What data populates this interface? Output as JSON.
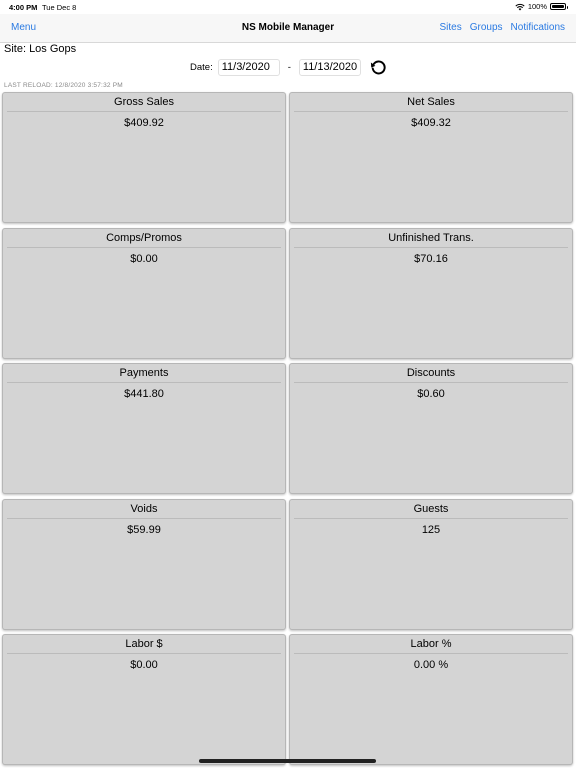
{
  "status_bar": {
    "time": "4:00 PM",
    "date": "Tue Dec 8",
    "battery": "100%",
    "battery_level": 1.0
  },
  "nav": {
    "menu_label": "Menu",
    "title": "NS Mobile Manager",
    "links": [
      "Sites",
      "Groups",
      "Notifications"
    ]
  },
  "site": {
    "label": "Site: Los Gops"
  },
  "date_range": {
    "label": "Date:",
    "start": "11/3/2020",
    "separator": "-",
    "end": "11/13/2020"
  },
  "last_reload": "LAST RELOAD: 12/8/2020 3:57:32 PM",
  "cards": [
    {
      "title": "Gross Sales",
      "value": "$409.92"
    },
    {
      "title": "Net Sales",
      "value": "$409.32"
    },
    {
      "title": "Comps/Promos",
      "value": "$0.00"
    },
    {
      "title": "Unfinished Trans.",
      "value": "$70.16"
    },
    {
      "title": "Payments",
      "value": "$441.80"
    },
    {
      "title": "Discounts",
      "value": "$0.60"
    },
    {
      "title": "Voids",
      "value": "$59.99"
    },
    {
      "title": "Guests",
      "value": "125"
    },
    {
      "title": "Labor $",
      "value": "$0.00"
    },
    {
      "title": "Labor %",
      "value": "0.00 %"
    }
  ],
  "colors": {
    "link": "#2a7ae2",
    "card_bg": "#d4d4d4"
  }
}
